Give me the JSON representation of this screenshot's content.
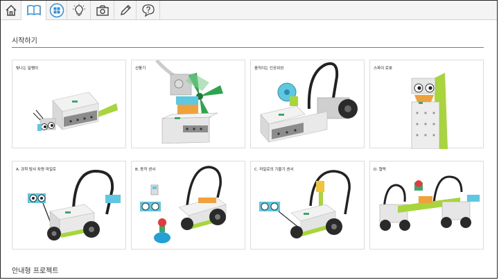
{
  "toolbar": {
    "buttons": [
      {
        "icon": "home-icon"
      },
      {
        "icon": "book-icon"
      },
      {
        "icon": "grid-icon"
      },
      {
        "icon": "lightbulb-icon"
      },
      {
        "icon": "camera-icon"
      },
      {
        "icon": "pencil-icon"
      },
      {
        "icon": "help-icon"
      }
    ],
    "accent": "#2f8fd8"
  },
  "sections": {
    "getting_started": "시작하기",
    "guided_projects": "안내형 프로젝트"
  },
  "cards": [
    {
      "label": "빛나는 달팽이"
    },
    {
      "label": "선풍기"
    },
    {
      "label": "움직이는 인공위성"
    },
    {
      "label": "스파이 로봇"
    },
    {
      "label": "A. 과학 탐사 차량 마일로"
    },
    {
      "label": "B. 동작 센서"
    },
    {
      "label": "C. 마일로의 기울기 센서"
    },
    {
      "label": "D. 협력"
    }
  ]
}
